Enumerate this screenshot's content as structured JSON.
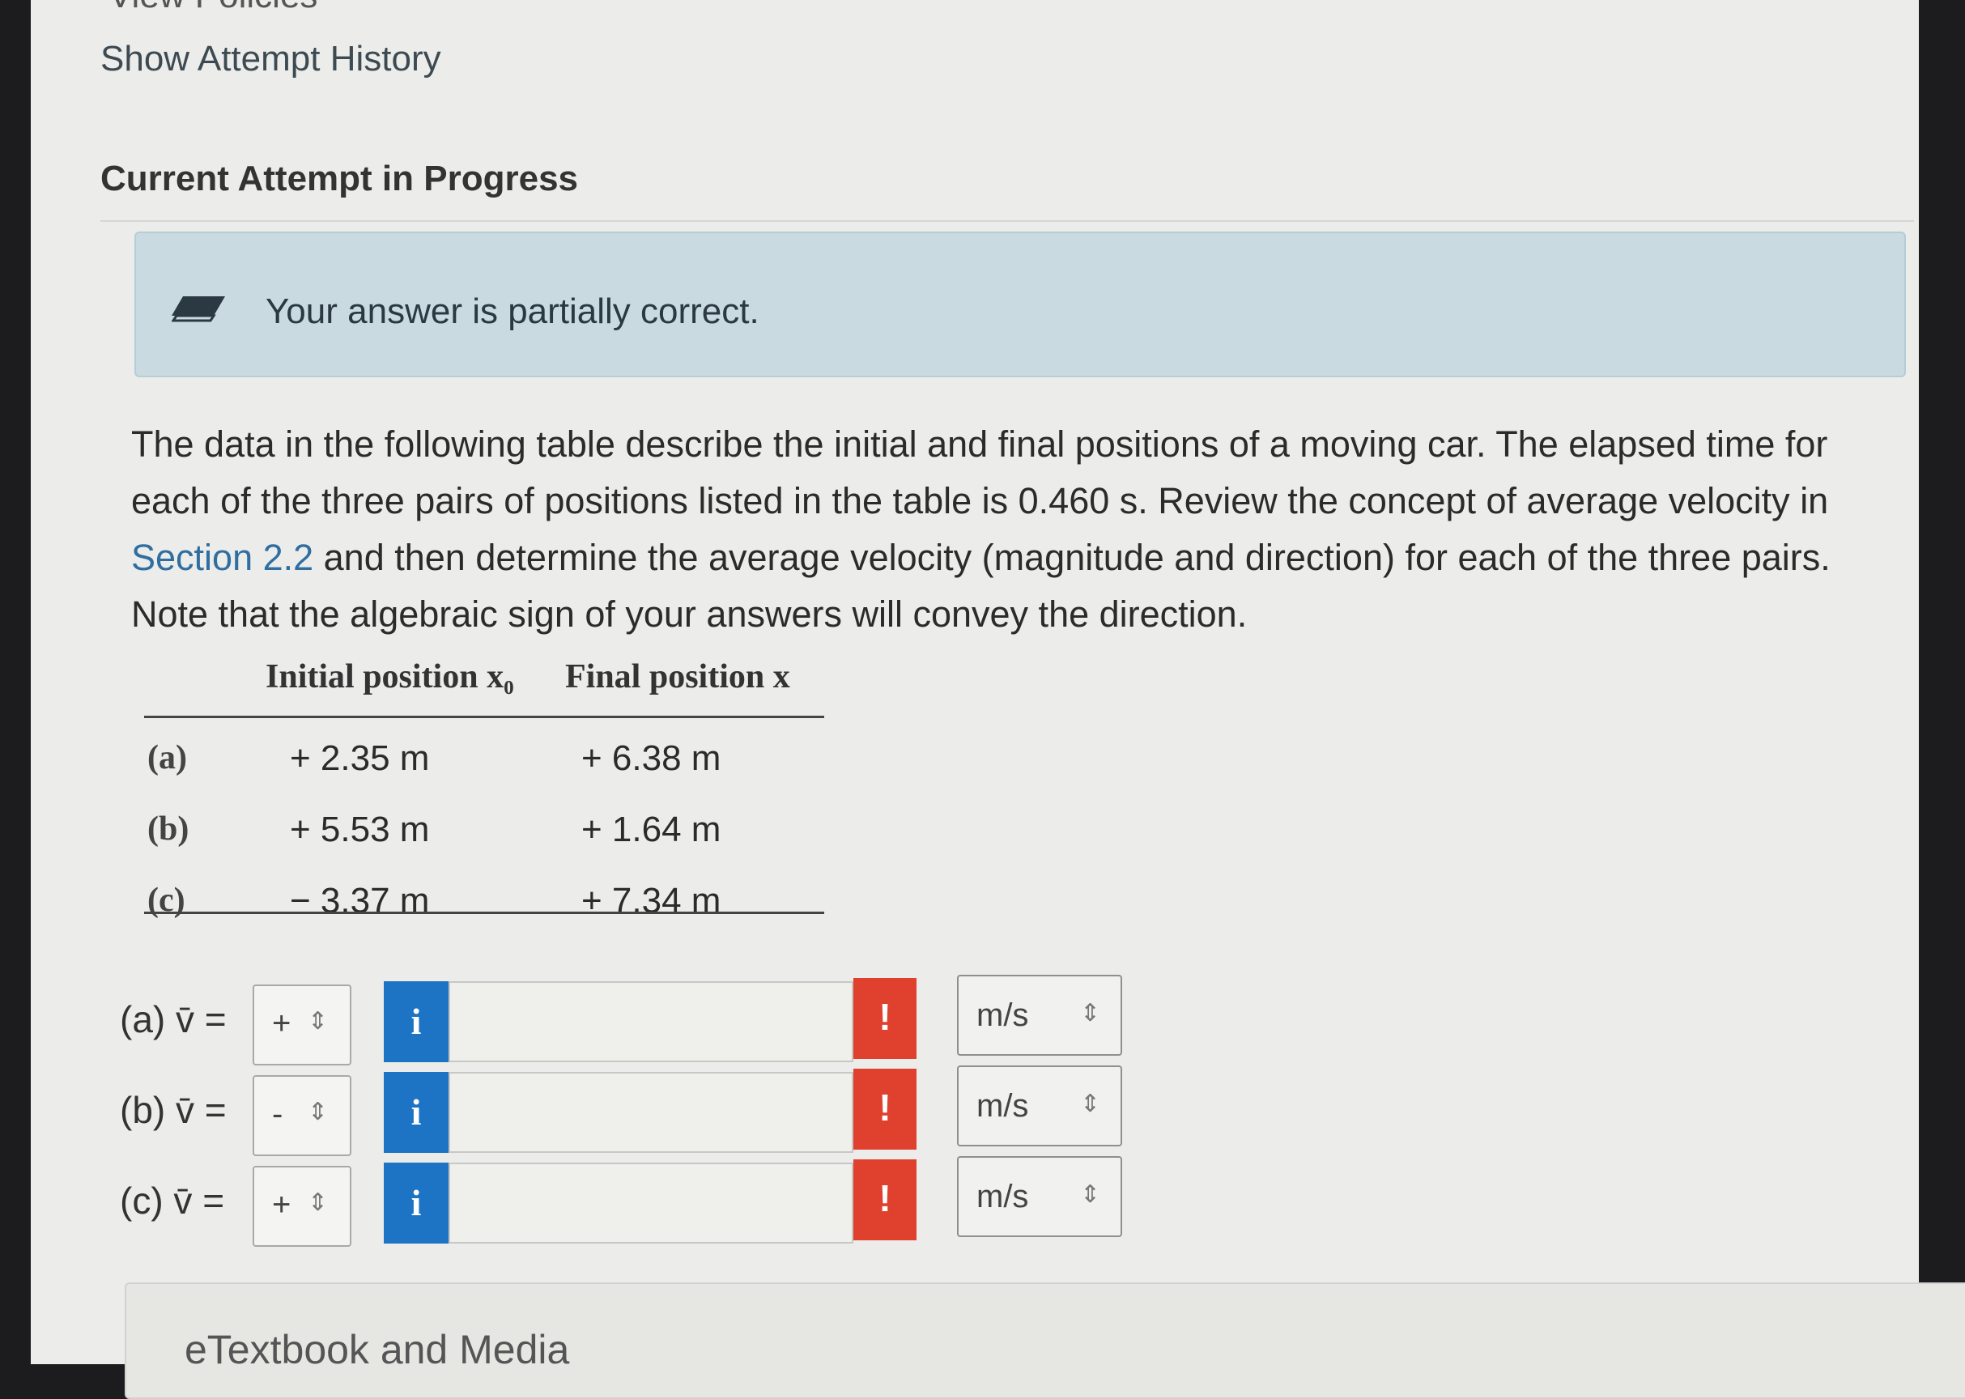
{
  "header": {
    "top_cut_text": "View Policies",
    "attempt_history_link": "Show Attempt History",
    "section_title": "Current Attempt in Progress"
  },
  "feedback": {
    "message": "Your answer is partially correct.",
    "icon": "pencil-icon"
  },
  "problem": {
    "text_before_link": "The data in the following table describe the initial and final positions of a moving car. The elapsed time for each of the three pairs of positions listed in the table is 0.460 s. Review the concept of average velocity in ",
    "link_text": "Section 2.2",
    "text_after_link": " and then determine the average velocity (magnitude and direction) for each of the three pairs. Note that the algebraic sign of your answers will convey the direction."
  },
  "table": {
    "headers": [
      "Initial position x₀",
      "Final position x"
    ],
    "rows": [
      {
        "label": "(a)",
        "initial": "+ 2.35 m",
        "final": "+ 6.38 m"
      },
      {
        "label": "(b)",
        "initial": "+ 5.53 m",
        "final": "+ 1.64 m"
      },
      {
        "label": "(c)",
        "initial": "− 3.37 m",
        "final": "+ 7.34 m"
      }
    ]
  },
  "answers": [
    {
      "label": "(a) v̄ =",
      "sign": "+",
      "value": "",
      "unit": "m/s",
      "info": "i",
      "error": "!"
    },
    {
      "label": "(b) v̄ =",
      "sign": "-",
      "value": "",
      "unit": "m/s",
      "info": "i",
      "error": "!"
    },
    {
      "label": "(c) v̄ =",
      "sign": "+",
      "value": "",
      "unit": "m/s",
      "info": "i",
      "error": "!"
    }
  ],
  "media_panel": {
    "title": "eTextbook and Media"
  },
  "colors": {
    "feedback_bg": "#c9dbe1",
    "info_button": "#1d74c5",
    "error_button": "#e0402e",
    "link": "#2f6ea0"
  }
}
